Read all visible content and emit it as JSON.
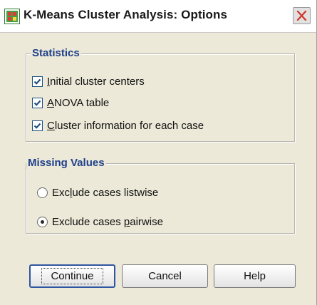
{
  "window": {
    "title": "K-Means Cluster Analysis: Options"
  },
  "statistics": {
    "legend": "Statistics",
    "items": [
      {
        "pre": "",
        "key": "I",
        "post": "nitial cluster centers",
        "checked": true
      },
      {
        "pre": "",
        "key": "A",
        "post": "NOVA table",
        "checked": true
      },
      {
        "pre": "",
        "key": "C",
        "post": "luster information for each case",
        "checked": true
      }
    ]
  },
  "missing_values": {
    "legend": "Missing Values",
    "options": [
      {
        "pre": "Exc",
        "key": "l",
        "post": "ude cases listwise",
        "selected": false
      },
      {
        "pre": "Exclude cases ",
        "key": "p",
        "post": "airwise",
        "selected": true
      }
    ]
  },
  "buttons": {
    "continue": "Continue",
    "cancel": "Cancel",
    "help": "Help"
  },
  "colors": {
    "group_title": "#1f3f8a",
    "check_blue": "#1c5180"
  },
  "icons": {
    "app": "spss-app-icon",
    "close": "close-icon"
  }
}
